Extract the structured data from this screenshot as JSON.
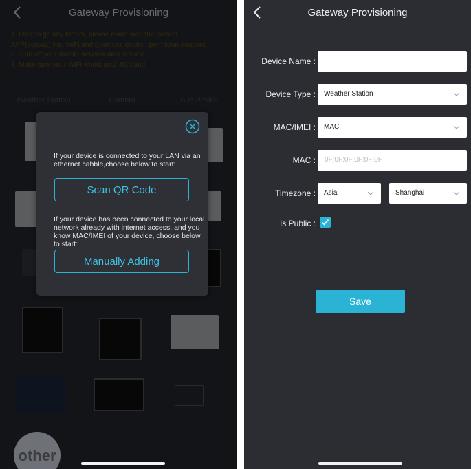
{
  "left": {
    "title": "Gateway Provisioning",
    "notice": [
      "1. Prior to go any further, please make sure the current",
      "APP(ecowitt) has WiFi and (precise) location permision enabled.",
      "2. Turn off your mobile network data service.",
      "3. Make sure your WiFi works on 2.4G band."
    ],
    "tabs": [
      "Weather Station",
      "Camera",
      "Sub-device"
    ],
    "other_label": "other",
    "modal": {
      "text1": "If your device is connected to your LAN via an ethernet cabble,choose below to start:",
      "button1": "Scan QR Code",
      "text2": "If your device has been connected to your local network already with internet access, and you know MAC/IMEI of your device, choose below to start:",
      "button2": "Manually Adding"
    }
  },
  "right": {
    "title": "Gateway Provisioning",
    "labels": {
      "device_name": "Device Name :",
      "device_type": "Device Type :",
      "mac_imei": "MAC/IMEI :",
      "mac": "MAC :",
      "timezone": "Timezone :",
      "is_public": "Is Public :"
    },
    "device_name_value": "",
    "device_type_value": "Weather Station",
    "mac_imei_value": "MAC",
    "mac_placeholder": "0F:0F:0F:0F:0F:0F",
    "timezone_region": "Asia",
    "timezone_city": "Shanghai",
    "is_public": true,
    "save_label": "Save"
  },
  "colors": {
    "background": "#2b2d33",
    "accent": "#2bb3d6",
    "modal_bg": "#2e3036"
  }
}
